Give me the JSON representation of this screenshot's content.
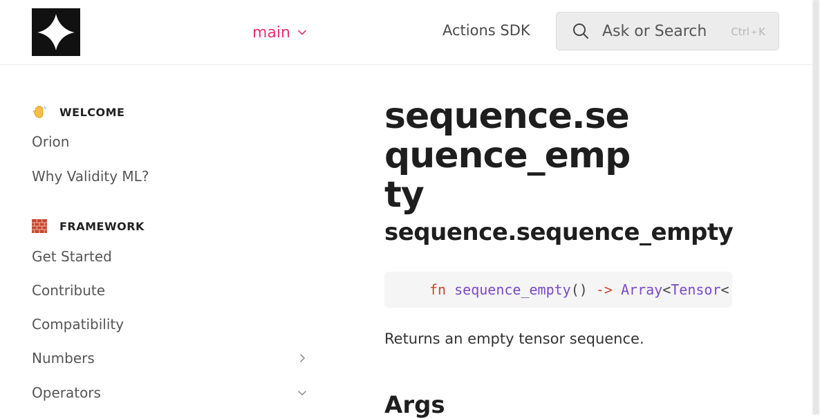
{
  "header": {
    "logo_name": "star-logo",
    "branch_label": "main",
    "nav_link": "Actions SDK",
    "search": {
      "placeholder": "Ask or Search",
      "shortcut_mod": "Ctrl",
      "shortcut_sep": "+",
      "shortcut_key": "K"
    }
  },
  "sidebar": {
    "sections": [
      {
        "emoji": "waving-hand",
        "title": "WELCOME",
        "items": [
          {
            "label": "Orion"
          },
          {
            "label": "Why Validity ML?"
          }
        ]
      },
      {
        "emoji": "brick",
        "title": "FRAMEWORK",
        "items": [
          {
            "label": "Get Started"
          },
          {
            "label": "Contribute"
          },
          {
            "label": "Compatibility"
          },
          {
            "label": "Numbers",
            "chevron": "right"
          },
          {
            "label": "Operators",
            "chevron": "down"
          }
        ]
      }
    ]
  },
  "main": {
    "title": "sequence.sequence_empty",
    "subtitle": "sequence.sequence_empty",
    "code": {
      "kw": "fn",
      "name": "sequence_empty",
      "parens": "()",
      "arrow": "->",
      "type1": "Array",
      "lt1": "<",
      "type2": "Tensor",
      "lt2": "<"
    },
    "description": "Returns an empty tensor sequence.",
    "args_heading": "Args"
  },
  "colors": {
    "accent": "#e8336e",
    "code_keyword": "#d1452f",
    "code_ident": "#7a48c9"
  }
}
